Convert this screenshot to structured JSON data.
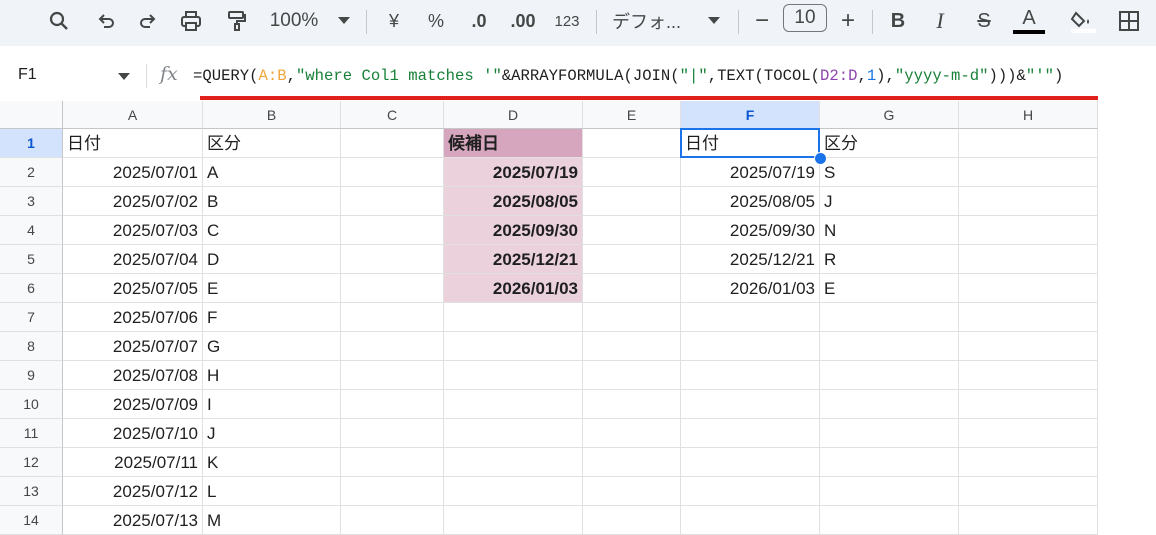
{
  "toolbar": {
    "zoom": "100%",
    "currency": "¥",
    "percent": "%",
    "dec_decrease": ".0",
    "dec_increase": ".00",
    "format_number": "123",
    "font": "デフォ...",
    "font_size": "10",
    "minus": "−",
    "plus": "+",
    "bold": "B",
    "italic": "I",
    "strike": "S",
    "text_color_letter": "A"
  },
  "formula_bar": {
    "name_box": "F1",
    "fx": "fx",
    "parts": {
      "p1": "=QUERY(",
      "p2": "A:B",
      "p3": ",",
      "p4": "\"where Col1 matches '\"",
      "p5": "&ARRAYFORMULA(JOIN(",
      "p6": "\"|\"",
      "p7": ",TEXT(TOCOL(",
      "p8": "D2:D",
      "p9": ",",
      "p10": "1",
      "p11": "),",
      "p12": "\"yyyy-m-d\"",
      "p13": ")))&",
      "p14": "\"'\"",
      "p15": ")"
    }
  },
  "columns": [
    "A",
    "B",
    "C",
    "D",
    "E",
    "F",
    "G",
    "H"
  ],
  "rows": [
    "1",
    "2",
    "3",
    "4",
    "5",
    "6",
    "7",
    "8",
    "9",
    "10",
    "11",
    "12",
    "13",
    "14"
  ],
  "cells": {
    "A": [
      "日付",
      "2025/07/01",
      "2025/07/02",
      "2025/07/03",
      "2025/07/04",
      "2025/07/05",
      "2025/07/06",
      "2025/07/07",
      "2025/07/08",
      "2025/07/09",
      "2025/07/10",
      "2025/07/11",
      "2025/07/12",
      "2025/07/13"
    ],
    "B": [
      "区分",
      "A",
      "B",
      "C",
      "D",
      "E",
      "F",
      "G",
      "H",
      "I",
      "J",
      "K",
      "L",
      "M"
    ],
    "D": [
      "候補日",
      "2025/07/19",
      "2025/08/05",
      "2025/09/30",
      "2025/12/21",
      "2026/01/03"
    ],
    "F": [
      "日付",
      "2025/07/19",
      "2025/08/05",
      "2025/09/30",
      "2025/12/21",
      "2026/01/03"
    ],
    "G": [
      "区分",
      "S",
      "J",
      "N",
      "R",
      "E"
    ]
  },
  "colors": {
    "toolbar_bg": "#f0f4f9",
    "candidate_header": "#d5a6bd",
    "candidate_fill": "#ead1dc",
    "selection": "#1a73e8",
    "highlight_line": "#e0201b"
  }
}
